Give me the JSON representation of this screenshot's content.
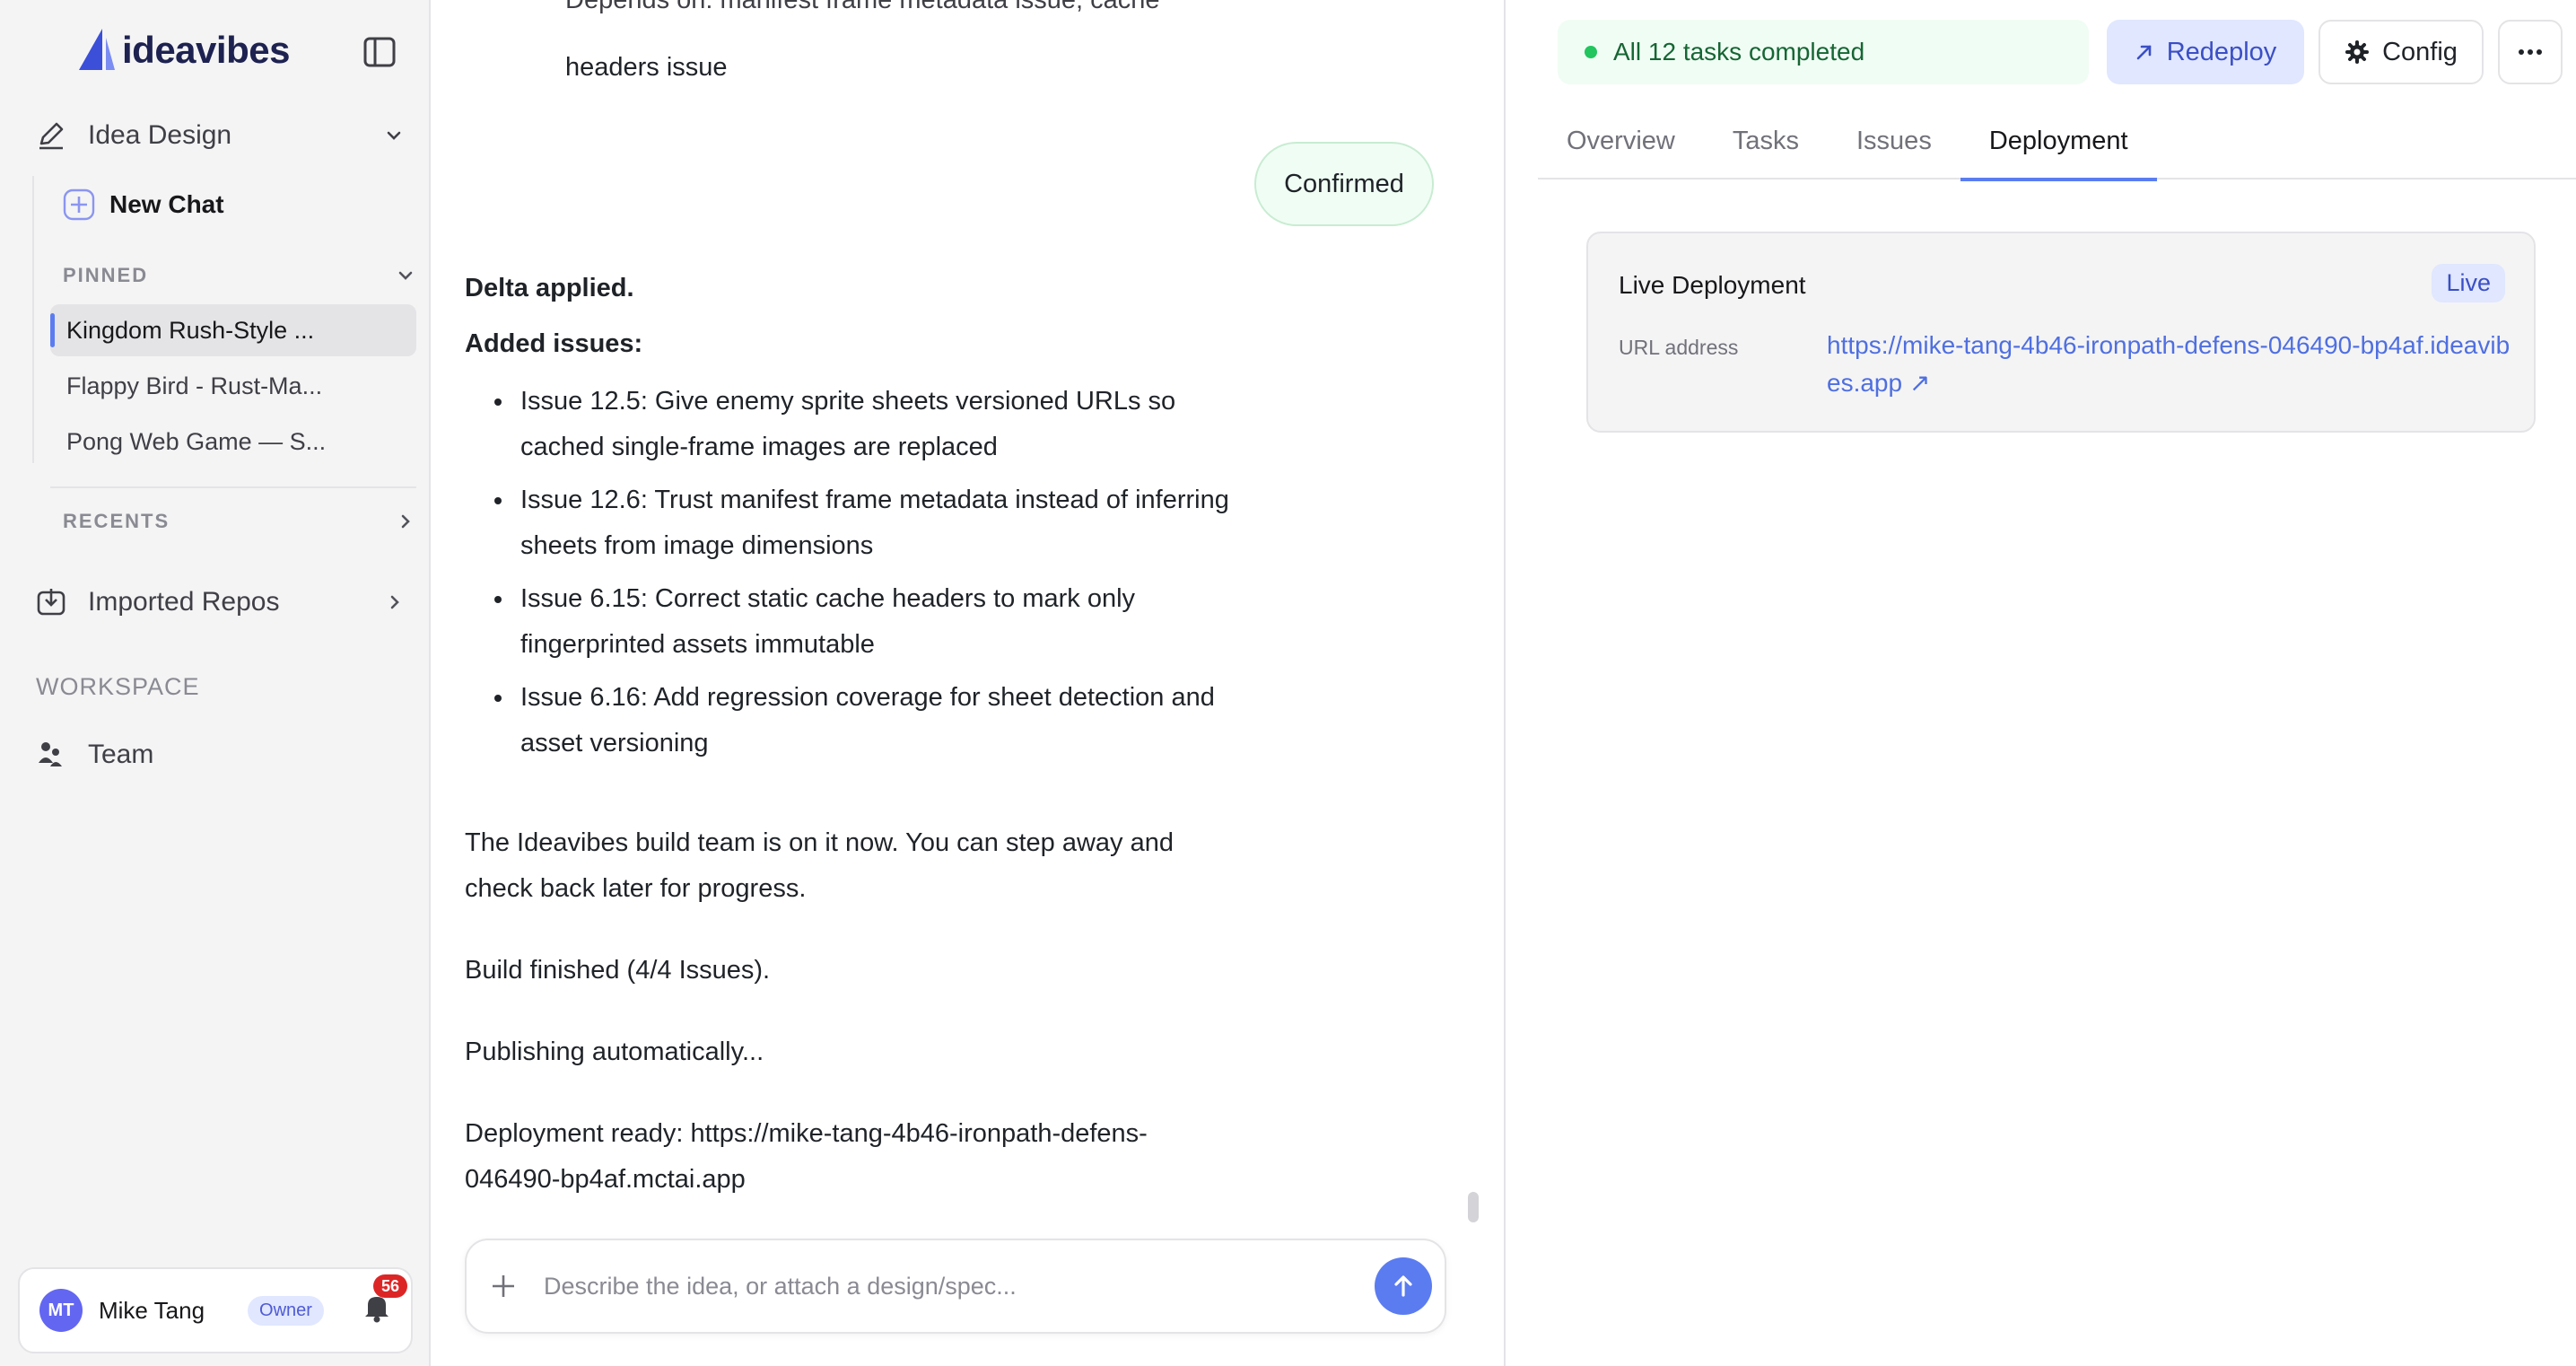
{
  "brand": {
    "name": "ideavibes",
    "accent": "#5b7cf0"
  },
  "sidebar": {
    "project_label": "Idea Design",
    "new_chat_label": "New Chat",
    "pinned_label": "PINNED",
    "pinned": [
      {
        "label": "Kingdom Rush-Style ..."
      },
      {
        "label": "Flappy Bird - Rust-Ma..."
      },
      {
        "label": "Pong Web Game — S..."
      }
    ],
    "recents_label": "RECENTS",
    "imported_repos_label": "Imported Repos",
    "workspace_label": "WORKSPACE",
    "team_label": "Team",
    "user": {
      "initials": "MT",
      "name": "Mike Tang",
      "role": "Owner",
      "notifications": "56"
    }
  },
  "chat": {
    "top_fragment_1": "Depends on: manifest frame metadata issue; cache",
    "top_fragment_2": "headers issue",
    "user_message": "Confirmed",
    "delta_heading": "Delta applied.",
    "added_heading": "Added issues:",
    "issues": [
      {
        "line1": "Issue 12.5: Give enemy sprite sheets versioned URLs so",
        "line2": "cached single-frame images are replaced"
      },
      {
        "line1": "Issue 12.6: Trust manifest frame metadata instead of inferring",
        "line2": "sheets from image dimensions"
      },
      {
        "line1": "Issue 6.15: Correct static cache headers to mark only",
        "line2": "fingerprinted assets immutable"
      },
      {
        "line1": "Issue 6.16: Add regression coverage for sheet detection and",
        "line2": "asset versioning"
      }
    ],
    "build_msg_1": "The Ideavibes build team is on it now. You can step away and",
    "build_msg_2": "check back later for progress.",
    "build_finished": "Build finished (4/4 Issues).",
    "publishing": "Publishing automatically...",
    "deploy_ready_1": "Deployment ready: https://mike-tang-4b46-ironpath-defens-",
    "deploy_ready_2": "046490-bp4af.mctai.app",
    "composer_placeholder": "Describe the idea, or attach a design/spec..."
  },
  "panel": {
    "status_text": "All 12 tasks completed",
    "redeploy_label": "Redeploy",
    "config_label": "Config",
    "tabs": [
      {
        "label": "Overview"
      },
      {
        "label": "Tasks"
      },
      {
        "label": "Issues"
      },
      {
        "label": "Deployment"
      }
    ],
    "active_tab": "Deployment",
    "deployment": {
      "title": "Live Deployment",
      "status": "Live",
      "url_label": "URL address",
      "url": "https://mike-tang-4b46-ironpath-defens-046490-bp4af.ideavibes.app ↗"
    }
  }
}
